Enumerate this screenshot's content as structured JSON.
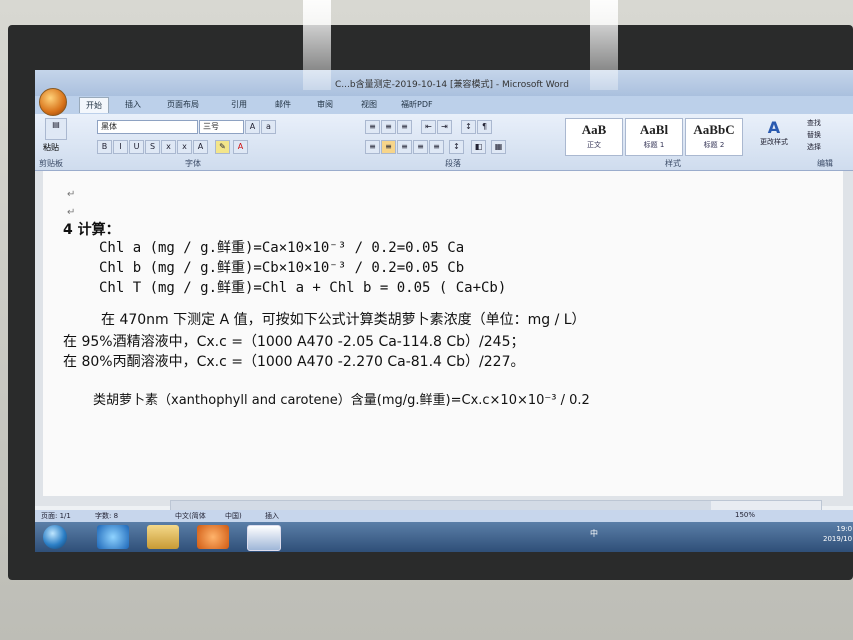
{
  "window": {
    "title": "C...b含量测定-2019-10-14 [兼容模式] - Microsoft Word"
  },
  "tabs": [
    "开始",
    "插入",
    "页面布局",
    "引用",
    "邮件",
    "审阅",
    "视图",
    "福昕PDF"
  ],
  "ribbon": {
    "font_name": "黑体",
    "font_size": "三号",
    "group_clipboard": "剪贴板",
    "paste_label": "粘贴",
    "group_font": "字体",
    "group_paragraph": "段落",
    "group_styles": "样式",
    "group_editing": "编辑",
    "styles": [
      {
        "sample": "AaB",
        "name": "正文"
      },
      {
        "sample": "AaBl",
        "name": "标题 1"
      },
      {
        "sample": "AaBbC",
        "name": "标题 2"
      }
    ],
    "change_styles": "更改样式",
    "find": "查找",
    "replace": "替换",
    "select": "选择"
  },
  "document": {
    "heading": "4 计算：",
    "lines": [
      "Chl a (mg / g.鲜重)=Ca×10×10⁻³ / 0.2=0.05 Ca",
      "Chl b (mg / g.鲜重)=Cb×10×10⁻³ / 0.2=0.05 Cb",
      "Chl T (mg / g.鲜重)=Chl a + Chl b = 0.05 ( Ca+Cb)",
      "在 470nm 下测定 A 值，可按如下公式计算类胡萝卜素浓度（单位：mg / L）",
      "在 95%酒精溶液中，Cx.c =（1000 A470 -2.05 Ca-114.8 Cb）/245；",
      "在 80%丙酮溶液中，Cx.c =（1000 A470 -2.270 Ca-81.4 Cb）/227。",
      "类胡萝卜素（xanthophyll and carotene）含量(mg/g.鲜重)=Cx.c×10×10⁻³ / 0.2"
    ]
  },
  "statusbar": {
    "page": "页面: 1/1",
    "words": "字数: 8",
    "language": "中文(简体",
    "region": "中国)",
    "insert": "插入",
    "zoom": "150%"
  },
  "taskbar": {
    "tray_text": "中 ",
    "time": "19:0",
    "date": "2019/10"
  }
}
